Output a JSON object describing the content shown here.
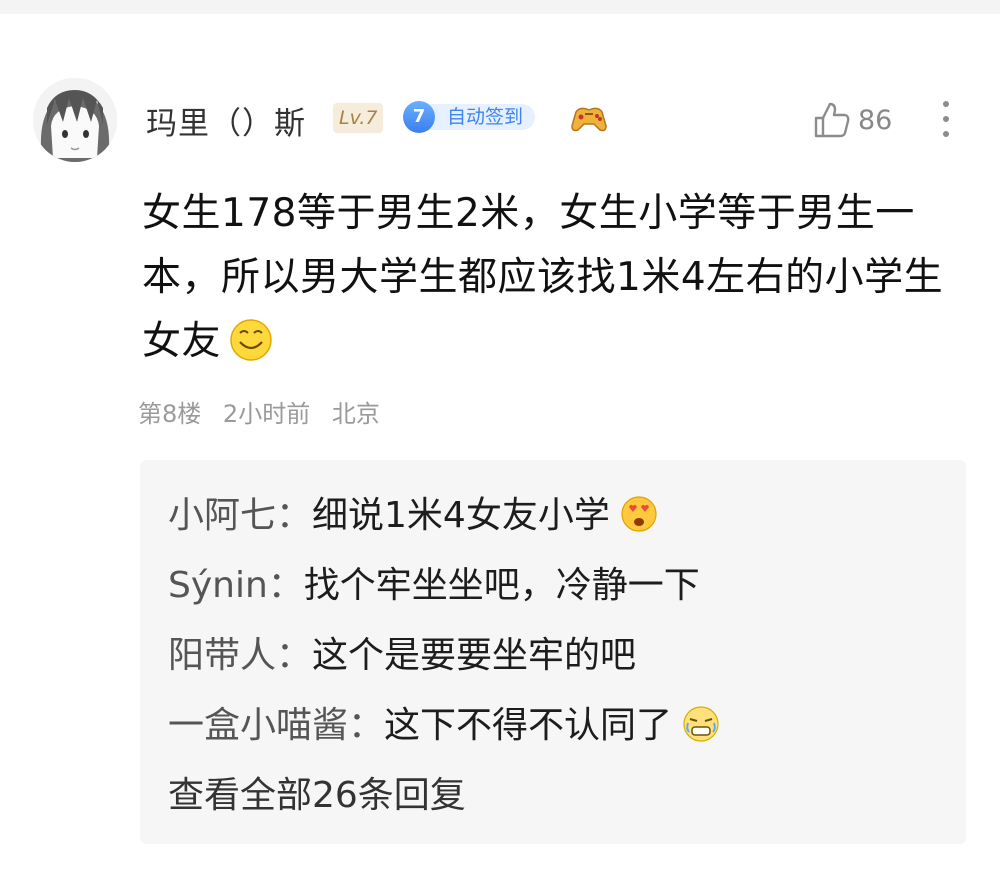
{
  "comment": {
    "username": "玛里（）斯",
    "level_badge": "Lv.7",
    "vip_level": "7",
    "checkin_badge": "自动签到",
    "like_count": "86",
    "text": "女生178等于男生2米，女生小学等于男生一本，所以男大学生都应该找1米4左右的小学生女友",
    "meta": {
      "floor": "第8楼",
      "time": "2小时前",
      "location": "北京"
    }
  },
  "replies": [
    {
      "author": "小阿七：",
      "text": "细说1米4女友小学",
      "emoji": "heart-eyes-emoji"
    },
    {
      "author": "Sýnin：",
      "text": "找个牢坐坐吧，冷静一下",
      "emoji": ""
    },
    {
      "author": "阳带人：",
      "text": "这个是要要坐牢的吧",
      "emoji": ""
    },
    {
      "author": "一盒小喵酱：",
      "text": "这下不得不认同了",
      "emoji": "crying-emoji"
    }
  ],
  "view_all_replies": "查看全部26条回复",
  "colors": {
    "level_bg": "#f5ecdc",
    "vip_blue": "#3f84f0",
    "meta_gray": "#9a9a9a",
    "reply_bg": "#f6f6f6"
  }
}
